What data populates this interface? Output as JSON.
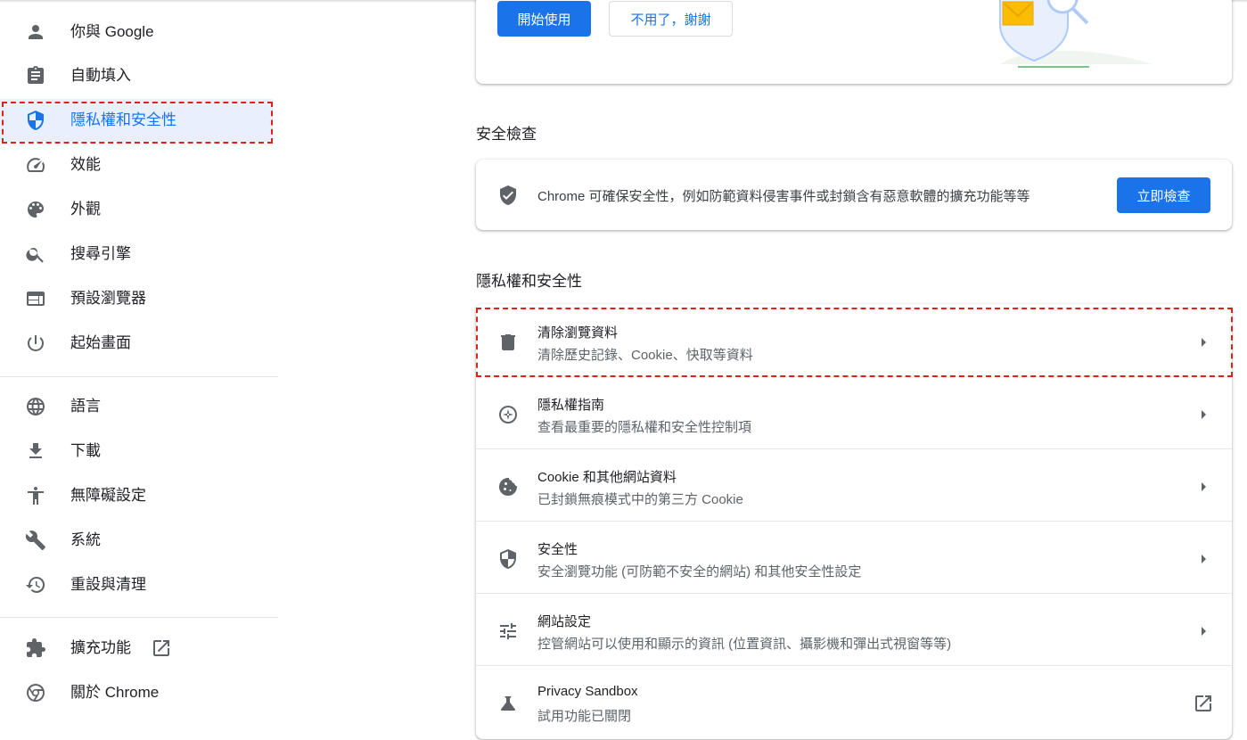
{
  "sidebar": {
    "items": [
      {
        "label": "你與 Google",
        "icon": "person-icon"
      },
      {
        "label": "自動填入",
        "icon": "clipboard-icon"
      },
      {
        "label": "隱私權和安全性",
        "icon": "shield-icon"
      },
      {
        "label": "效能",
        "icon": "speedometer-icon"
      },
      {
        "label": "外觀",
        "icon": "palette-icon"
      },
      {
        "label": "搜尋引擎",
        "icon": "search-icon"
      },
      {
        "label": "預設瀏覽器",
        "icon": "browser-window-icon"
      },
      {
        "label": "起始畫面",
        "icon": "power-icon"
      },
      {
        "label": "語言",
        "icon": "globe-icon"
      },
      {
        "label": "下載",
        "icon": "download-icon"
      },
      {
        "label": "無障礙設定",
        "icon": "accessibility-icon"
      },
      {
        "label": "系統",
        "icon": "wrench-icon"
      },
      {
        "label": "重設與清理",
        "icon": "history-icon"
      },
      {
        "label": "擴充功能",
        "icon": "puzzle-icon"
      },
      {
        "label": "關於 Chrome",
        "icon": "chrome-icon"
      }
    ]
  },
  "promo": {
    "start_label": "開始使用",
    "decline_label": "不用了，謝謝"
  },
  "safety_check": {
    "section_title": "安全檢查",
    "description": "Chrome 可確保安全性，例如防範資料侵害事件或封鎖含有惡意軟體的擴充功能等等",
    "button_label": "立即檢查"
  },
  "privacy": {
    "section_title": "隱私權和安全性",
    "rows": [
      {
        "title": "清除瀏覽資料",
        "subtitle": "清除歷史記錄、Cookie、快取等資料",
        "icon": "trash-icon"
      },
      {
        "title": "隱私權指南",
        "subtitle": "查看最重要的隱私權和安全性控制項",
        "icon": "compass-icon"
      },
      {
        "title": "Cookie 和其他網站資料",
        "subtitle": "已封鎖無痕模式中的第三方 Cookie",
        "icon": "cookie-icon"
      },
      {
        "title": "安全性",
        "subtitle": "安全瀏覽功能 (可防範不安全的網站) 和其他安全性設定",
        "icon": "security-shield-icon"
      },
      {
        "title": "網站設定",
        "subtitle": "控管網站可以使用和顯示的資訊 (位置資訊、攝影機和彈出式視窗等等)",
        "icon": "sliders-icon"
      },
      {
        "title": "Privacy Sandbox",
        "subtitle": "試用功能已關閉",
        "icon": "flask-icon"
      }
    ]
  },
  "colors": {
    "accent": "#1a73e8",
    "active_bg": "#e8f0fe",
    "highlight": "#e0201b"
  }
}
